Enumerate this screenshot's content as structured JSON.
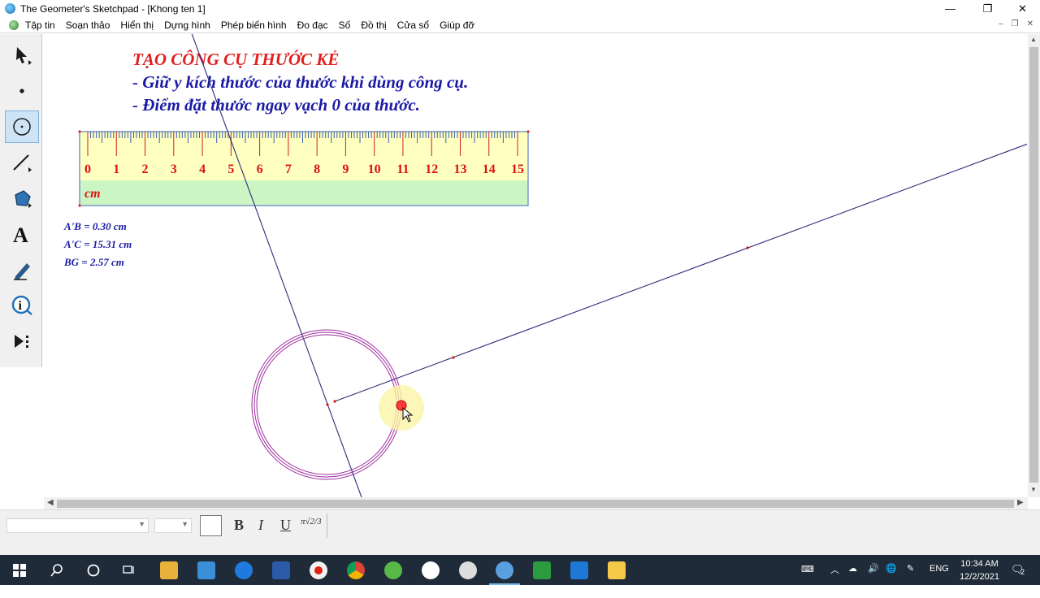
{
  "window": {
    "title": "The Geometer's Sketchpad - [Khong ten 1]",
    "minimize": "—",
    "restore": "❐",
    "close": "✕"
  },
  "menu": [
    "Tập tin",
    "Soạn thảo",
    "Hiển thị",
    "Dựng hình",
    "Phép biến hình",
    "Đo đạc",
    "Số",
    "Đồ thị",
    "Cửa sổ",
    "Giúp đỡ"
  ],
  "mdi_buttons": [
    "–",
    "❐",
    "✕"
  ],
  "tools": [
    "arrow-tool",
    "point-tool",
    "compass-tool",
    "straightedge-tool",
    "polygon-tool",
    "text-tool",
    "marker-tool",
    "information-tool",
    "custom-tool"
  ],
  "sketch": {
    "heading": "TẠO CÔNG CỤ THƯỚC KẺ",
    "line1": "- Giữ y kích thước của thước khi dùng công cụ.",
    "line2": "- Điểm đặt thước ngay vạch 0 của thước.",
    "ruler_numbers": [
      "0",
      "1",
      "2",
      "3",
      "4",
      "5",
      "6",
      "7",
      "8",
      "9",
      "10",
      "11",
      "12",
      "13",
      "14",
      "15"
    ],
    "ruler_unit": "cm",
    "measurements": [
      "A'B = 0.30 cm",
      "A'C = 15.31 cm",
      "BG = 2.57 cm"
    ]
  },
  "textbar": {
    "bold": "B",
    "italic": "I",
    "underline": "U",
    "math": "π√2/3"
  },
  "taskbar": {
    "language": "ENG",
    "time": "10:34 AM",
    "date": "12/2/2021",
    "notifications": "2"
  },
  "colors": {
    "heading": "#e02020",
    "instructions": "#1a1aa6",
    "ruler_numbers": "#dd1111",
    "ruler_top": "#ffffc0",
    "ruler_bottom": "#ccf5c4",
    "circle": "#9c2a9c",
    "line": "#2c2c7a"
  }
}
